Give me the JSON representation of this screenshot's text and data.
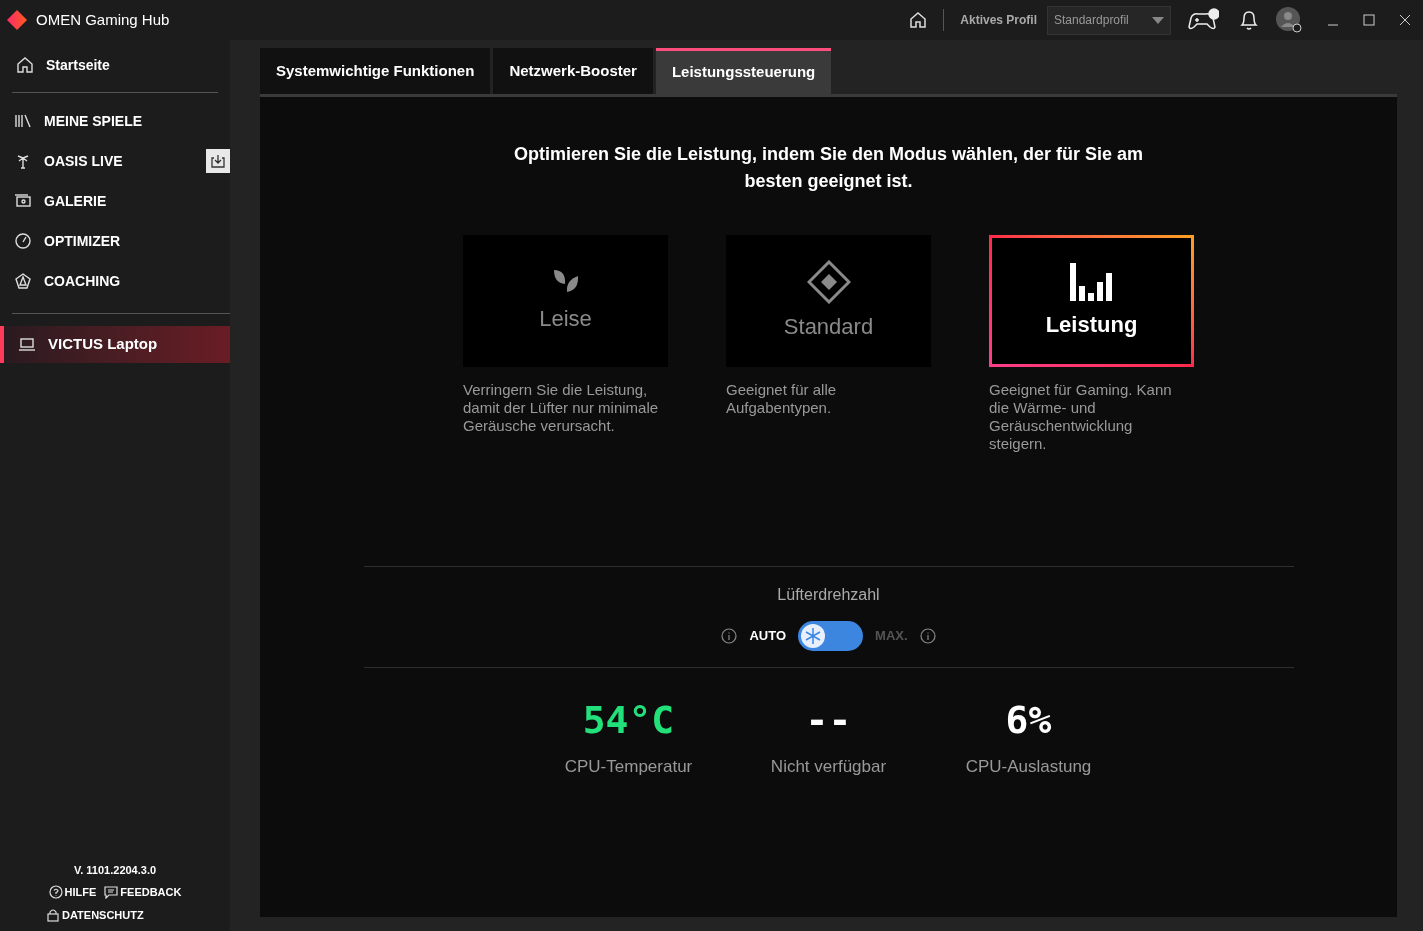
{
  "window": {
    "title": "OMEN Gaming Hub"
  },
  "top_bar": {
    "profile_label": "Aktives Profil",
    "profile_value": "Standardprofil"
  },
  "sidebar": {
    "home": {
      "label": "Startseite",
      "selected": false
    },
    "items": [
      {
        "label": "MEINE SPIELE",
        "selected": false,
        "download": false
      },
      {
        "label": "OASIS LIVE",
        "selected": false,
        "download": true
      },
      {
        "label": "GALERIE",
        "selected": false,
        "download": false
      },
      {
        "label": "OPTIMIZER",
        "selected": false,
        "download": false
      },
      {
        "label": "COACHING",
        "selected": false,
        "download": false
      }
    ],
    "device": {
      "label": "VICTUS Laptop",
      "selected": true
    },
    "version": "V. 1101.2204.3.0",
    "links": [
      {
        "label": "HILFE"
      },
      {
        "label": "FEEDBACK"
      },
      {
        "label": "DATENSCHUTZ"
      }
    ]
  },
  "tabs": [
    {
      "label": "Systemwichtige Funktionen",
      "selected": false
    },
    {
      "label": "Netzwerk-Booster",
      "selected": false
    },
    {
      "label": "Leistungssteuerung",
      "selected": true
    }
  ],
  "heading": "Optimieren Sie die Leistung, indem Sie den Modus wählen, der für Sie am besten geeignet ist.",
  "modes": [
    {
      "label": "Leise",
      "selected": false,
      "description": "Verringern Sie die Leistung, damit der Lüfter nur minimale Geräusche verursacht."
    },
    {
      "label": "Standard",
      "selected": false,
      "description": "Geeignet für alle Aufgabentypen."
    },
    {
      "label": "Leistung",
      "selected": true,
      "description": "Geeignet für Gaming. Kann die Wärme- und Geräuschentwicklung steigern."
    }
  ],
  "fan": {
    "title": "Lüfterdrehzahl",
    "auto_label": "AUTO",
    "max_label": "MAX.",
    "max": false
  },
  "stats": [
    {
      "value": "54°C",
      "label": "CPU-Temperatur",
      "color": "#22e07a"
    },
    {
      "value": "--",
      "label": "Nicht verfügbar",
      "color": "#ffffff"
    },
    {
      "value": "6%",
      "label": "CPU-Auslastung",
      "color": "#ffffff"
    }
  ]
}
